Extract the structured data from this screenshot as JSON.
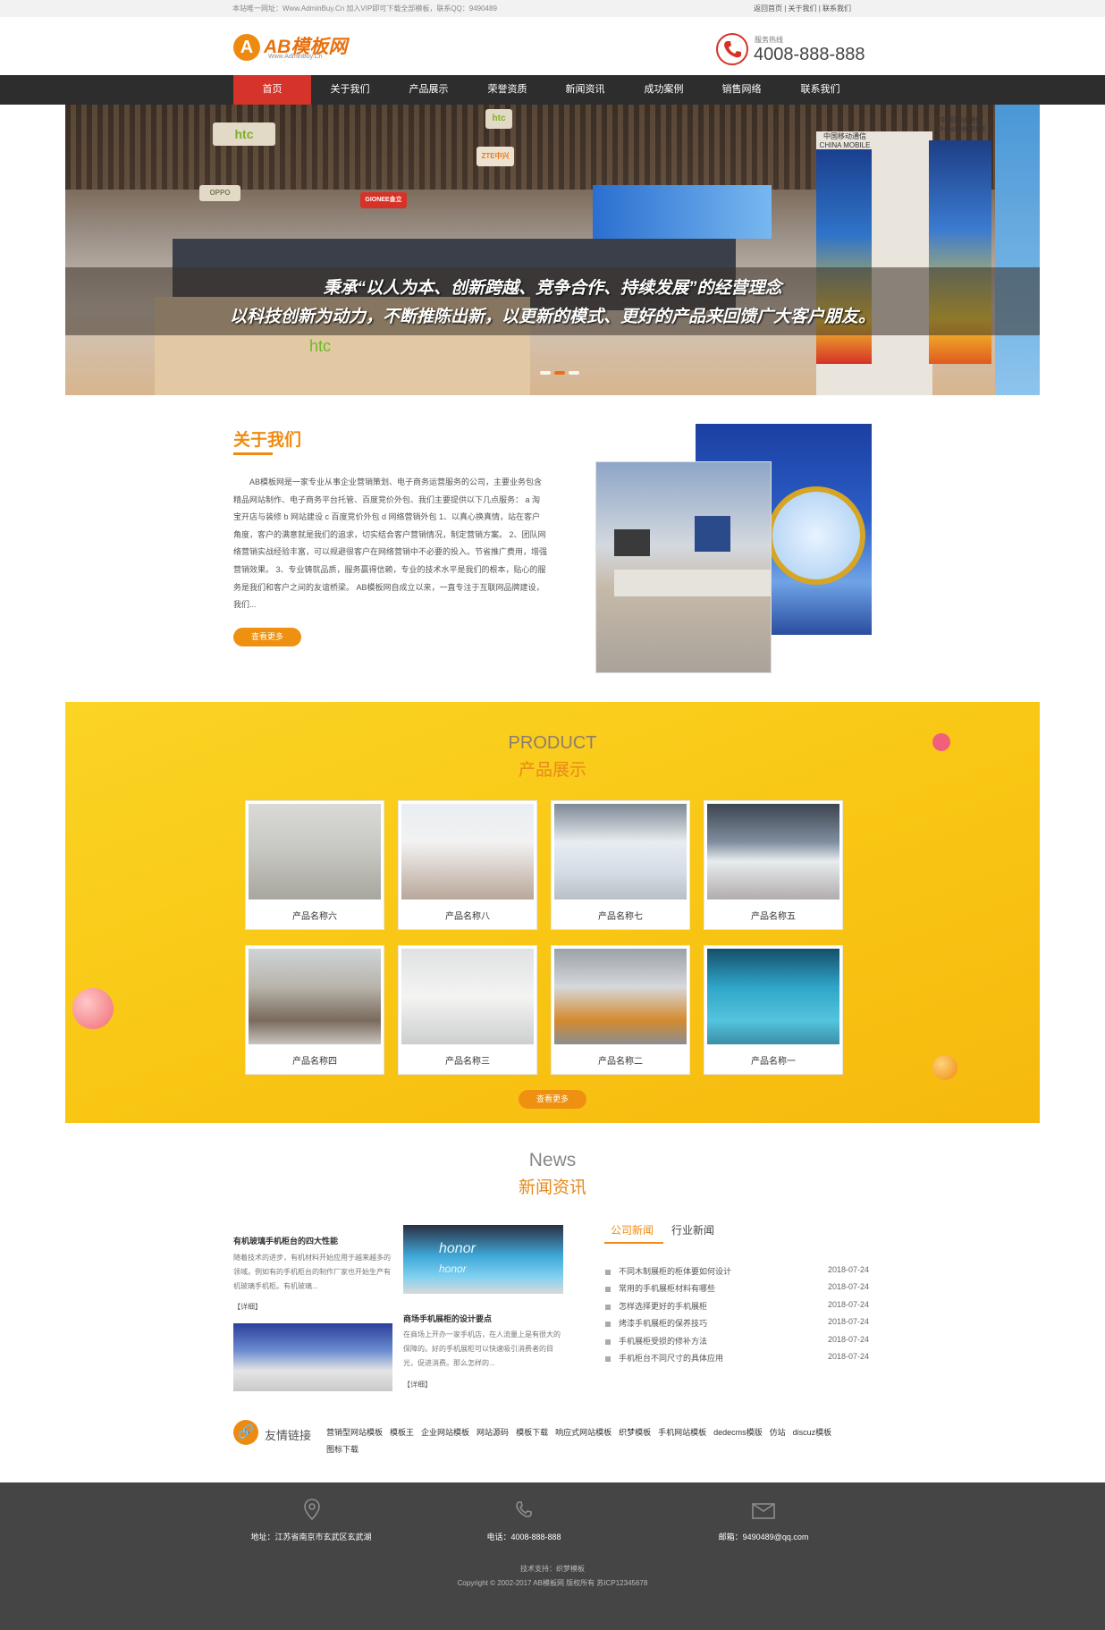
{
  "topbar": {
    "left": "本站唯一网址：Www.AdminBuy.Cn 加入VIP即可下载全部模板，联系QQ：9490489",
    "right": "返回首页 | 关于我们 | 联系我们"
  },
  "header": {
    "logo_mark": "A",
    "logo_title": "AB模板网",
    "logo_sub": "Www.AdminBuy.Cn",
    "phone_label": "服务热线",
    "phone_number": "4008-888-888",
    "phone_icon": "phone-icon"
  },
  "nav": {
    "items": [
      "首页",
      "关于我们",
      "产品展示",
      "荣誉资质",
      "新闻资讯",
      "成功案例",
      "销售网络",
      "联系我们"
    ],
    "active_index": 0,
    "active_color": "#d6332b"
  },
  "banner": {
    "sign_htc": "htc",
    "sign_zte": "ZTE中兴",
    "sign_oppo": "OPPO",
    "sign_gionee": "GIONEE金立",
    "sign_htc2": "htc",
    "sign_cmcc1": "中国移动通信 CHINA MOBILE",
    "sign_cmcc2": "中国移动通信 CHINA MOBILE",
    "slogan1": "秉承“以人为本、创新跨越、竞争合作、持续发展”的经营理念",
    "slogan2": "以科技创新为动力，不断推陈出新，以更新的模式、更好的产品来回馈广大客户朋友。",
    "dots": 3,
    "active_dot": 1
  },
  "about": {
    "title": "关于我们",
    "text": "AB模板网是一家专业从事企业营销策划、电子商务运营服务的公司，主要业务包含精品网站制作、电子商务平台托管、百度竞价外包、我们主要提供以下几点服务： a 淘宝开店与装修 b 网站建设 c 百度竞价外包 d 网络营销外包 1、以真心换真情，站在客户角度，客户的满意就是我们的追求，切实结合客户营销情况，制定营销方案。 2、团队网络营销实战经验丰富，可以规避很客户在网络营销中不必要的投入。节省推广费用，增强营销效果。 3、专业铸就品质，服务赢得信赖，专业的技术水平是我们的根本，贴心的服务是我们和客户之间的友谊桥梁。 AB模板网自成立以来，一直专注于互联网品牌建设，我们...",
    "button": "查看更多"
  },
  "products": {
    "title_en": "PRODUCT",
    "title_cn": "产品展示",
    "items": [
      {
        "name": "产品名称六"
      },
      {
        "name": "产品名称八"
      },
      {
        "name": "产品名称七"
      },
      {
        "name": "产品名称五"
      },
      {
        "name": "产品名称四"
      },
      {
        "name": "产品名称三"
      },
      {
        "name": "产品名称二"
      },
      {
        "name": "产品名称一"
      }
    ],
    "button": "查看更多"
  },
  "news": {
    "title_en": "News",
    "title_cn": "新闻资讯",
    "feature1": {
      "title": "有机玻璃手机柜台的四大性能",
      "text": "随着技术的进步，有机材料开始应用于越来越多的领域。例如有的手机柜台的制作厂家也开始生产有机玻璃手机柜。有机玻璃...",
      "more": "【详细】"
    },
    "feature2": {
      "title": "商场手机展柜的设计要点",
      "text": "在商场上开办一家手机店，在人流量上是有很大的保障的。好的手机展柜可以快速吸引消费者的目光，促进消费。那么怎样的...",
      "more": "【详细】"
    },
    "img1_text": "honor",
    "tabs": [
      "公司新闻",
      "行业新闻"
    ],
    "list": [
      {
        "title": "不同木制展柜的柜体要如何设计",
        "date": "2018-07-24"
      },
      {
        "title": "常用的手机展柜材料有哪些",
        "date": "2018-07-24"
      },
      {
        "title": "怎样选择更好的手机展柜",
        "date": "2018-07-24"
      },
      {
        "title": "烤漆手机展柜的保养技巧",
        "date": "2018-07-24"
      },
      {
        "title": "手机展柜受损的修补方法",
        "date": "2018-07-24"
      },
      {
        "title": "手机柜台不同尺寸的具体应用",
        "date": "2018-07-24"
      }
    ]
  },
  "links": {
    "title": "友情链接",
    "icon": "link-icon",
    "items": [
      "营销型网站模板",
      "模板王",
      "企业网站模板",
      "网站源码",
      "模板下载",
      "响应式网站模板",
      "织梦模板",
      "手机网站模板",
      "dedecms模版",
      "仿站",
      "discuz模板",
      "图标下载"
    ]
  },
  "footer": {
    "address": "地址：江苏省南京市玄武区玄武湖",
    "phone": "电话：4008-888-888",
    "email": "邮箱：9490489@qq.com",
    "support": "技术支持：织梦模板",
    "copyright": "Copyright © 2002-2017 AB模板网 版权所有   苏ICP12345678",
    "icons": [
      "location-icon",
      "phone-icon",
      "mail-icon"
    ]
  }
}
